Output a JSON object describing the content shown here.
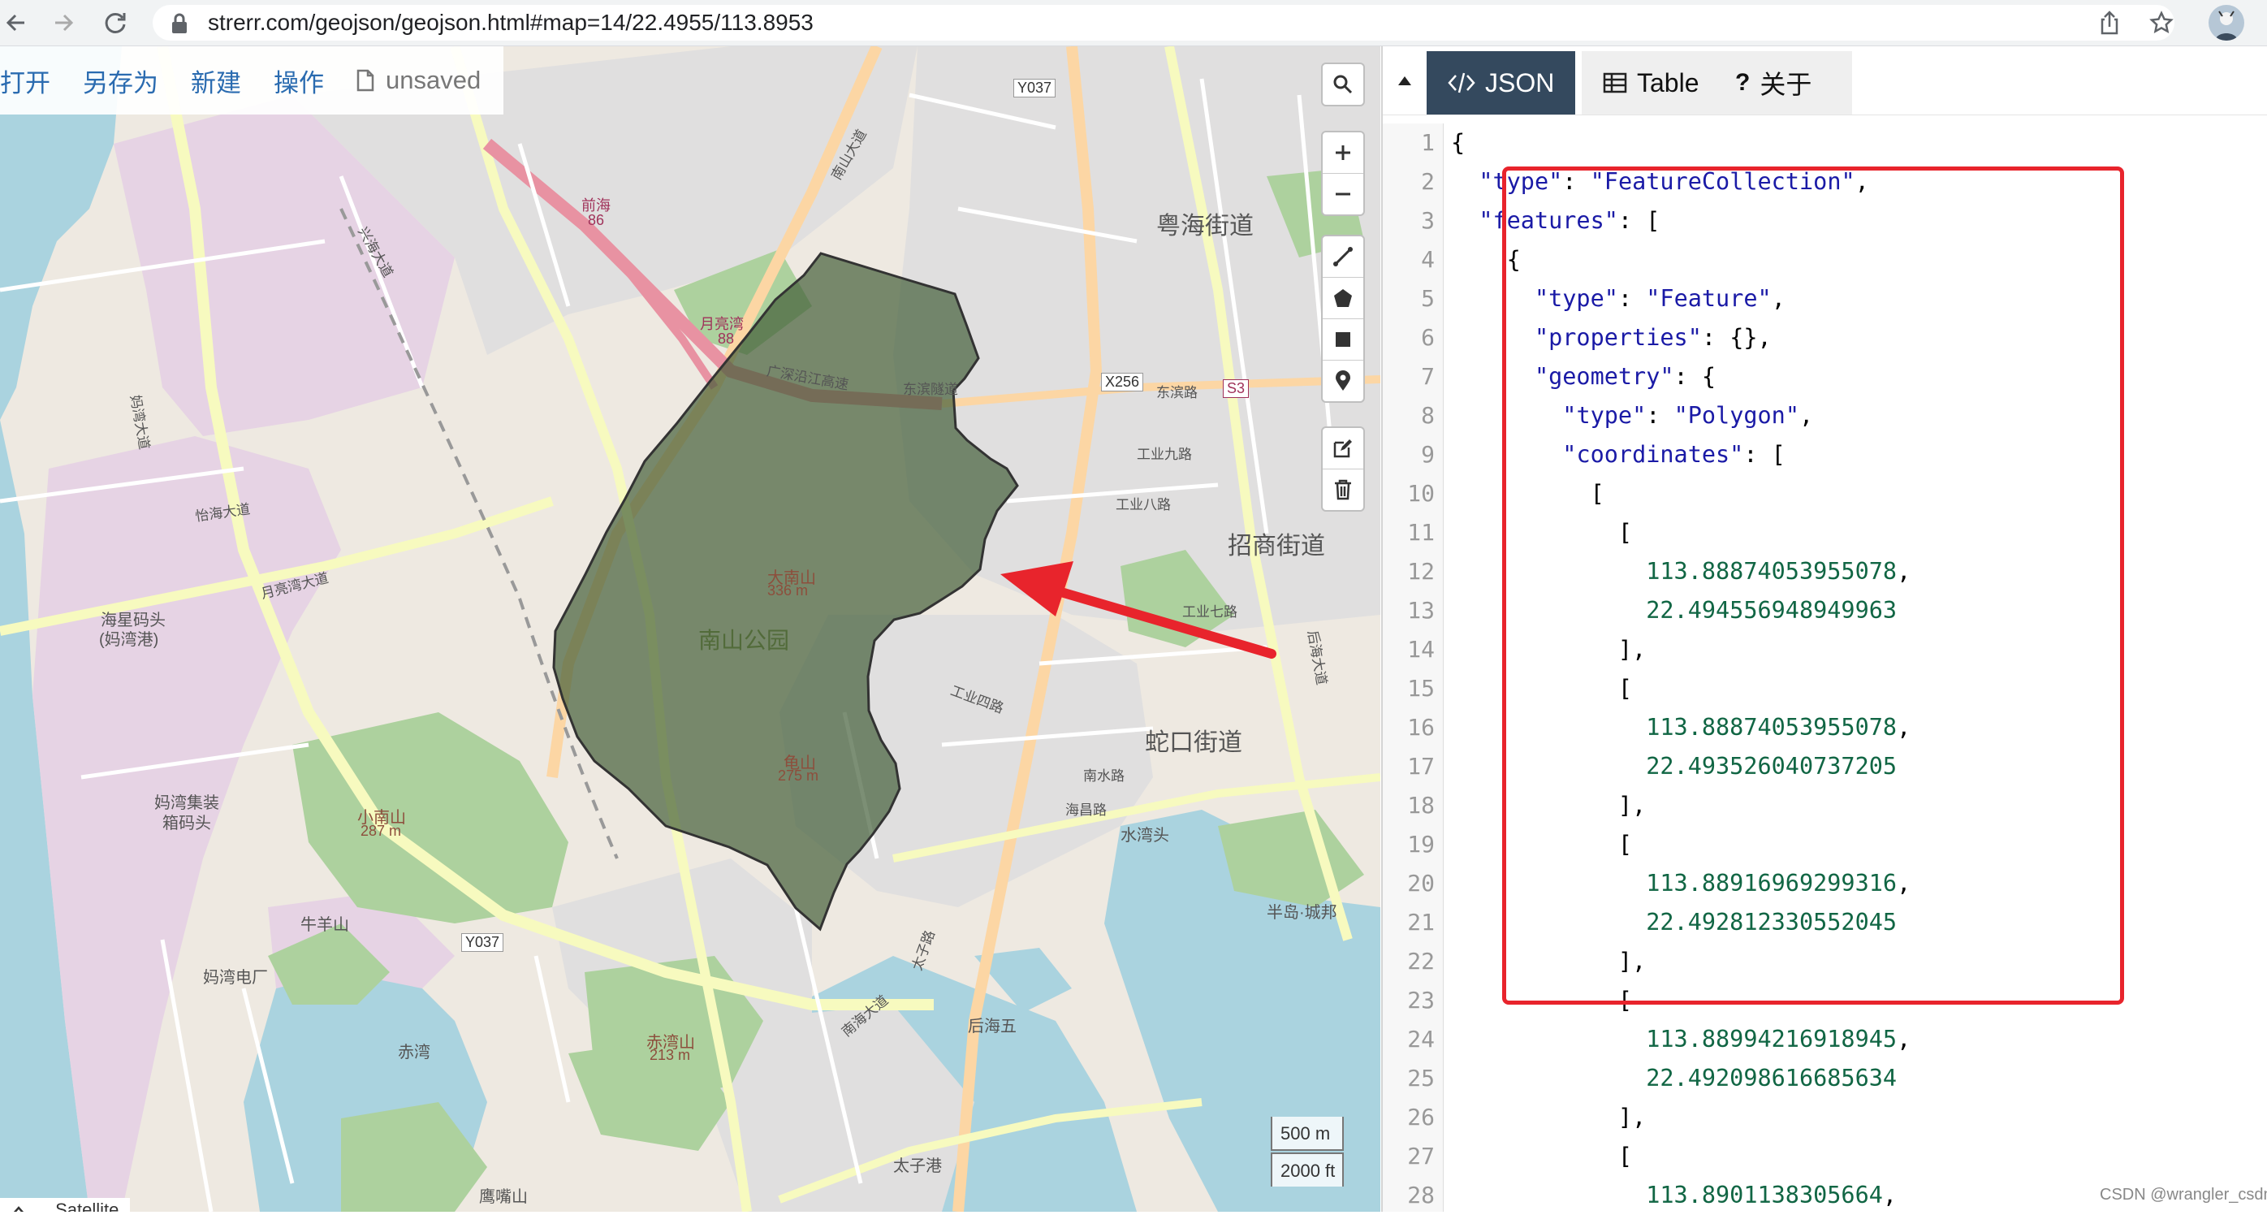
{
  "browser": {
    "url": "strerr.com/geojson/geojson.html#map=14/22.4955/113.8953"
  },
  "menu": {
    "open": "打开",
    "save_as": "另存为",
    "new": "新建",
    "operations": "操作",
    "file_status": "unsaved"
  },
  "tabs": [
    {
      "label": "JSON",
      "icon": "code-icon"
    },
    {
      "label": "Table",
      "icon": "table-icon"
    },
    {
      "label": "关于",
      "icon": "help-icon"
    }
  ],
  "map": {
    "labels": {
      "park": "南山公园",
      "da_nanshan": "大南山",
      "da_nanshan_elev": "336 m",
      "guishan": "龟山",
      "guishan_elev": "275 m",
      "xiao_nanshan": "小南山",
      "xiao_nanshan_elev": "287 m",
      "chiwanshan": "赤湾山",
      "chiwanshan_elev": "213 m",
      "yuehai": "粤海街道",
      "zhaoshang": "招商街道",
      "shekou": "蛇口街道",
      "haixing": "海星码头",
      "haixing_sub": "(妈湾港)",
      "mawan_zhuang": "妈湾集装",
      "mawan_zhuang2": "箱码头",
      "mawan_power": "妈湾电厂",
      "niuyangshan": "牛羊山",
      "yingzuishan": "鹰嘴山",
      "chiwan": "赤湾",
      "houhai": "后海大道",
      "houhai_lake": "后海五",
      "bandao": "半岛·城邦",
      "shuiwan": "水湾头",
      "taizigang": "太子港",
      "qianhai": "前海",
      "qianhai_num": "86",
      "yueliangwan": "月亮湾",
      "yueliangwan_num": "88",
      "road_y037a": "Y037",
      "road_y037b": "Y037",
      "road_x256": "X256",
      "road_s3": "S3",
      "dongbin": "东滨隧道",
      "dongbin_road": "东滨路",
      "guangshen": "广深沿江高速",
      "gongye7": "工业七路",
      "gongye8": "工业八路",
      "gongye9": "工业九路",
      "gongye4": "工业四路",
      "nanhai": "南海大道",
      "taizi": "太子路",
      "nanshui": "南水路",
      "haichang": "海昌路",
      "mawan_road": "妈湾大道",
      "yihai": "怡海大道",
      "yuewan": "月亮湾大道",
      "xinghai": "兴海大道",
      "nanshan_ave": "南山大道",
      "satellite": "Satellite"
    },
    "scale": {
      "metric": "500 m",
      "imperial": "2000 ft"
    }
  },
  "editor": {
    "lines": [
      {
        "n": "1",
        "t": "{"
      },
      {
        "n": "2",
        "t": "  \"type\": \"FeatureCollection\","
      },
      {
        "n": "3",
        "t": "  \"features\": ["
      },
      {
        "n": "4",
        "t": "    {"
      },
      {
        "n": "5",
        "t": "      \"type\": \"Feature\","
      },
      {
        "n": "6",
        "t": "      \"properties\": {},"
      },
      {
        "n": "7",
        "t": "      \"geometry\": {"
      },
      {
        "n": "8",
        "t": "        \"type\": \"Polygon\","
      },
      {
        "n": "9",
        "t": "        \"coordinates\": ["
      },
      {
        "n": "10",
        "t": "          ["
      },
      {
        "n": "11",
        "t": "            ["
      },
      {
        "n": "12",
        "t": "              113.88874053955078,"
      },
      {
        "n": "13",
        "t": "              22.494556948949963"
      },
      {
        "n": "14",
        "t": "            ],"
      },
      {
        "n": "15",
        "t": "            ["
      },
      {
        "n": "16",
        "t": "              113.88874053955078,"
      },
      {
        "n": "17",
        "t": "              22.493526040737205"
      },
      {
        "n": "18",
        "t": "            ],"
      },
      {
        "n": "19",
        "t": "            ["
      },
      {
        "n": "20",
        "t": "              113.88916969299316,"
      },
      {
        "n": "21",
        "t": "              22.492812330552045"
      },
      {
        "n": "22",
        "t": "            ],"
      },
      {
        "n": "23",
        "t": "            ["
      },
      {
        "n": "24",
        "t": "              113.88994216918945,"
      },
      {
        "n": "25",
        "t": "              22.492098616685634"
      },
      {
        "n": "26",
        "t": "            ],"
      },
      {
        "n": "27",
        "t": "            ["
      },
      {
        "n": "28",
        "t": "              113.8901138305664,"
      }
    ]
  },
  "watermark": "CSDN @wrangler_csdn",
  "colors": {
    "tab_active": "#34495e",
    "menu_link": "#2a6bb0",
    "json_key": "#1a1aa6",
    "json_number": "#116644",
    "highlight": "#e8242c",
    "polygon_fill": "#3e5a33"
  }
}
